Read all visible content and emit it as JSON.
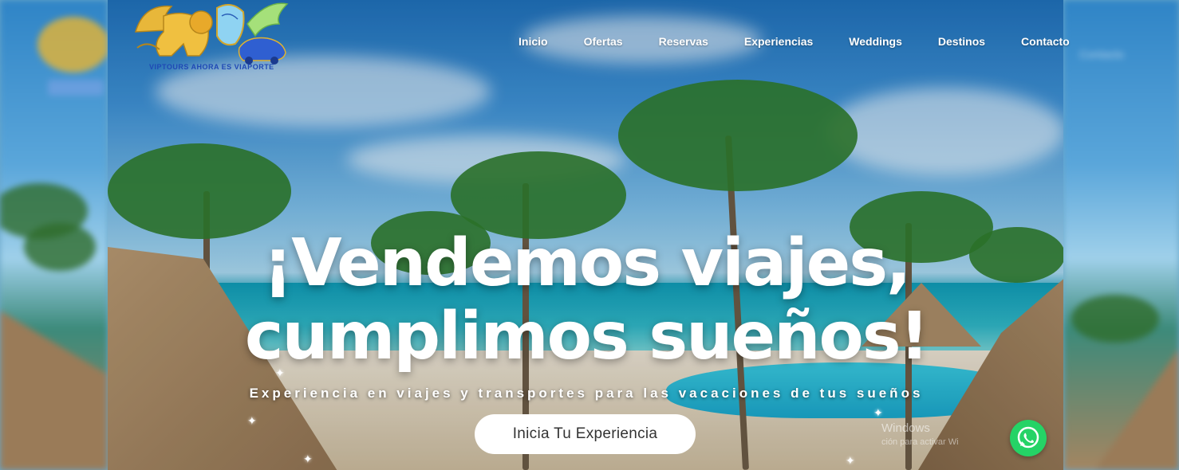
{
  "logo": {
    "caption": "VIPTOURS AHORA ES VIAPORTE",
    "icon": "griffin-lion-car-logo"
  },
  "nav": {
    "items": [
      {
        "label": "Inicio"
      },
      {
        "label": "Ofertas"
      },
      {
        "label": "Reservas"
      },
      {
        "label": "Experiencias"
      },
      {
        "label": "Weddings"
      },
      {
        "label": "Destinos"
      },
      {
        "label": "Contacto"
      }
    ]
  },
  "hero": {
    "headline_line1": "¡Vendemos viajes,",
    "headline_line2": "cumplimos sueños!",
    "subtitle": "Experiencia en viajes y transportes para las vacaciones de tus sueños",
    "cta_label": "Inicia Tu Experiencia"
  },
  "watermark": {
    "title": "Windows",
    "text": "ción para activar Wi"
  },
  "side_right": {
    "ghost_nav": "Contacto"
  },
  "whatsapp": {
    "icon": "whatsapp-icon",
    "color": "#25d366"
  },
  "colors": {
    "nav_text": "#ffffff",
    "logo_text": "#1f49b5",
    "cta_bg": "#ffffff"
  }
}
